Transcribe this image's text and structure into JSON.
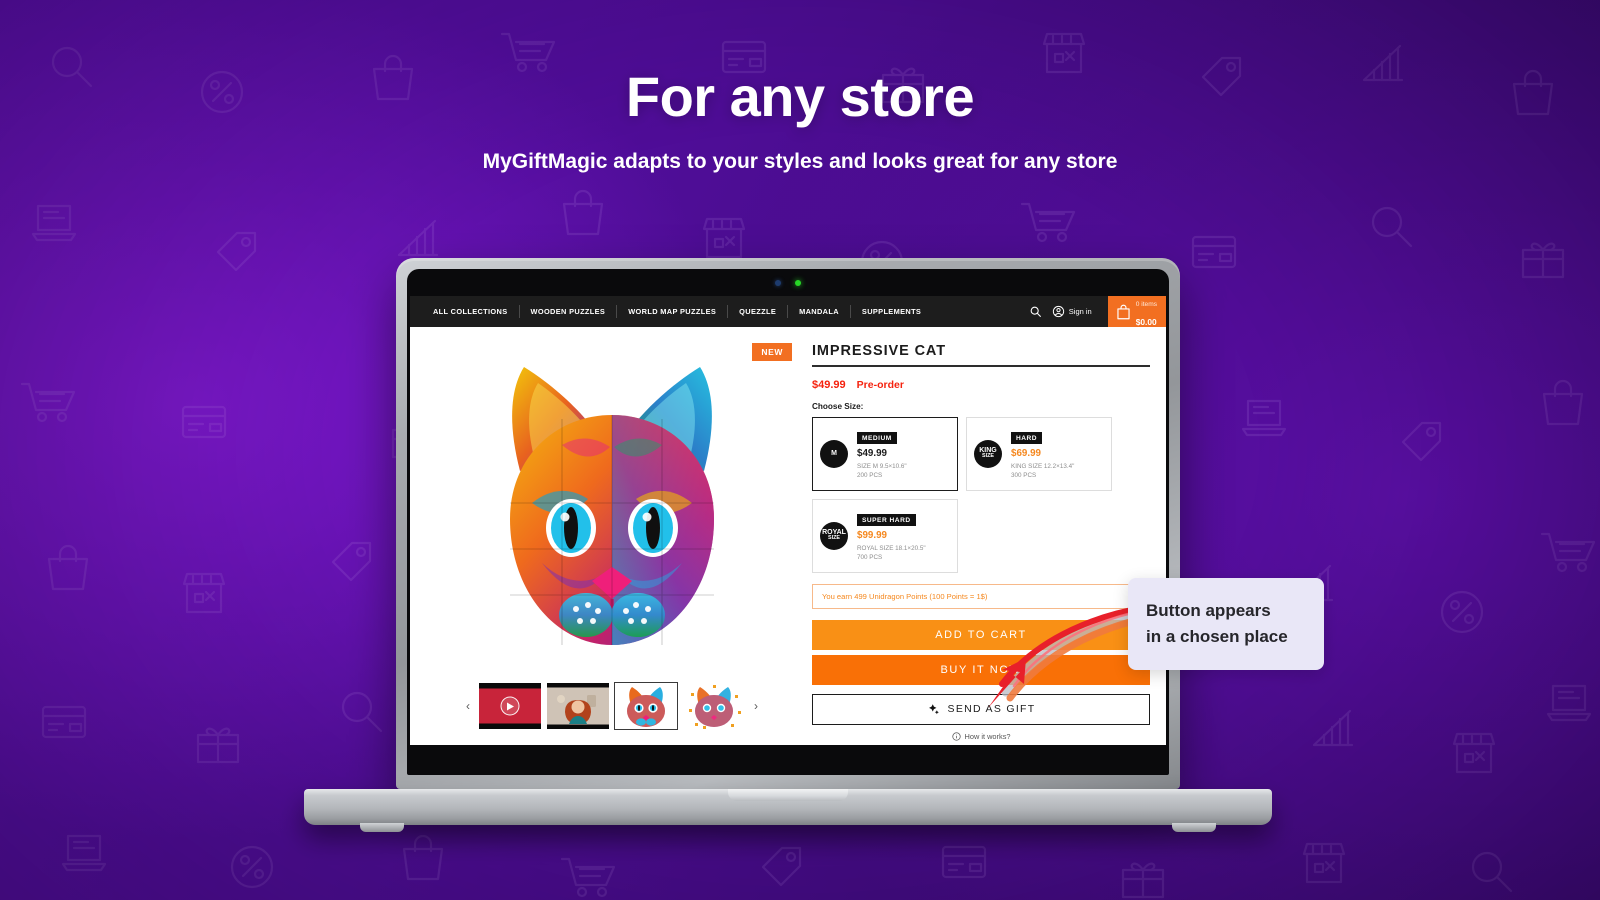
{
  "header": {
    "headline": "For any store",
    "subheadline": "MyGiftMagic adapts to your styles\nand looks great for any store"
  },
  "colors": {
    "background_purple": "#4c0a86",
    "accent_orange": "#f26f21",
    "cta_orange": "#f99015",
    "buy_orange": "#f97006",
    "price_red": "#f5230f",
    "points_orange": "#f5881f",
    "nav_dark": "#1d1d1d",
    "callout_bg": "#e9e7f7",
    "arrow_red": "#e8202a"
  },
  "site_nav": {
    "links": [
      "ALL COLLECTIONS",
      "WOODEN PUZZLES",
      "WORLD MAP PUZZLES",
      "QUEZZLE",
      "MANDALA",
      "SUPPLEMENTS"
    ],
    "search_icon": "search-icon",
    "account_icon": "account-circle-icon",
    "signin_label": "Sign in",
    "cart_icon": "shopping-bag-icon",
    "cart_items": "0 items",
    "cart_total": "$0.00"
  },
  "gallery": {
    "new_badge": "NEW",
    "prev_arrow": "‹",
    "next_arrow": "›",
    "thumbnails": [
      {
        "name": "video-thumbnail-red",
        "type": "video",
        "selected": false
      },
      {
        "name": "video-thumbnail-person",
        "type": "video",
        "selected": false
      },
      {
        "name": "puzzle-photo-thumbnail",
        "type": "image",
        "selected": true
      },
      {
        "name": "puzzle-pieces-thumbnail",
        "type": "image",
        "selected": false
      }
    ]
  },
  "product": {
    "title": "IMPRESSIVE CAT",
    "price": "$49.99",
    "availability": "Pre-order",
    "choose_size_label": "Choose Size:",
    "sizes": [
      {
        "circle_line1": "M",
        "circle_line2": "",
        "difficulty": "MEDIUM",
        "price": "$49.99",
        "dimensions": "SIZE M 9.5×10.6\"",
        "pieces": "200 PCS",
        "selected": true,
        "price_accent": false
      },
      {
        "circle_line1": "KING",
        "circle_line2": "SIZE",
        "difficulty": "HARD",
        "price": "$69.99",
        "dimensions": "KING SIZE 12.2×13.4\"",
        "pieces": "300 PCS",
        "selected": false,
        "price_accent": true
      },
      {
        "circle_line1": "ROYAL",
        "circle_line2": "SIZE",
        "difficulty": "SUPER HARD",
        "price": "$99.99",
        "dimensions": "ROYAL SIZE 18.1×20.5\"",
        "pieces": "700 PCS",
        "selected": false,
        "price_accent": true
      }
    ],
    "points_message": "You earn 499 Unidragon Points (100 Points = 1$)",
    "add_to_cart_label": "ADD TO CART",
    "buy_it_now_label": "BUY IT NOW",
    "send_as_gift_label": "SEND AS GIFT",
    "send_as_gift_icon": "gift-sparkle-icon",
    "how_it_works_label": "How it works?",
    "how_it_works_icon": "info-circle-icon"
  },
  "callout": {
    "text": "Button appears\nin a chosen place"
  },
  "device": {
    "type": "laptop",
    "camera_indicator": "green"
  }
}
